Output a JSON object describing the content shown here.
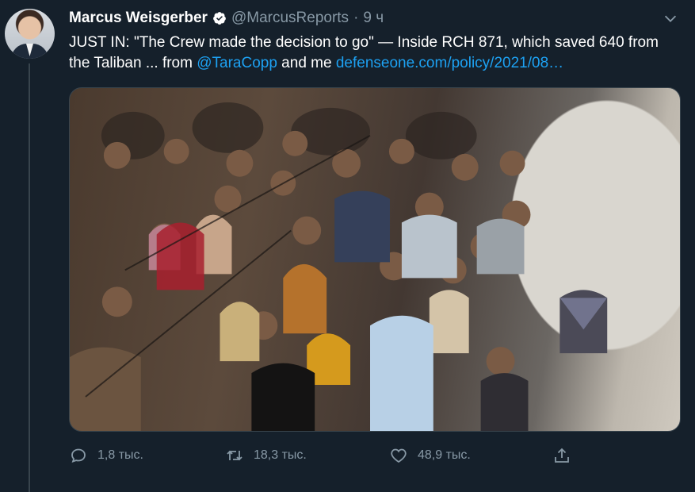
{
  "tweet": {
    "author_name": "Marcus Weisgerber",
    "handle": "@MarcusReports",
    "separator": "·",
    "time": "9 ч",
    "text_plain_1": "JUST IN: \"The Crew made the decision to go\" — Inside RCH 871, which saved 640 from the Taliban ... from ",
    "mention": "@TaraCopp",
    "text_plain_2": " and me ",
    "link": "defenseone.com/policy/2021/08…"
  },
  "actions": {
    "reply_count": "1,8 тыс.",
    "retweet_count": "18,3 тыс.",
    "like_count": "48,9 тыс."
  },
  "icons": {
    "verified": "verified-badge-icon",
    "more": "chevron-down-icon",
    "reply": "comment-bubble-icon",
    "retweet": "retweet-icon",
    "like": "heart-icon",
    "share": "share-icon"
  },
  "colors": {
    "background": "#15202b",
    "link": "#1da1f2",
    "secondary_text": "#8899a6"
  }
}
